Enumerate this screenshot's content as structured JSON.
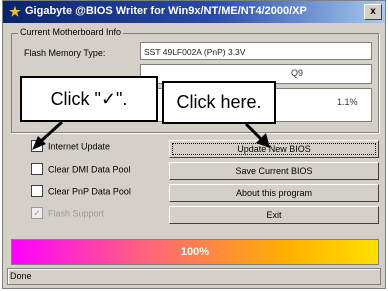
{
  "window": {
    "title": "Gigabyte @BIOS Writer for Win9x/NT/ME/NT4/2000/XP",
    "close_label": "x"
  },
  "info": {
    "legend": "Current Motherboard Info",
    "flash_label": "Flash Memory Type:",
    "flash_value": "SST 49LF002A (PnP) 3.3V",
    "frag1": "Q9",
    "frag2": "1.1%"
  },
  "options": [
    {
      "label": "Internet Update",
      "checked": false,
      "disabled": false
    },
    {
      "label": "Clear DMI Data Pool",
      "checked": false,
      "disabled": false
    },
    {
      "label": "Clear PnP Data Pool",
      "checked": false,
      "disabled": false
    },
    {
      "label": "Flash Support",
      "checked": true,
      "disabled": true
    }
  ],
  "buttons": [
    {
      "label": "Update New BIOS"
    },
    {
      "label": "Save Current BIOS"
    },
    {
      "label": "About this program"
    },
    {
      "label": "Exit"
    }
  ],
  "progress": {
    "value": 100,
    "text": "100%"
  },
  "status": {
    "text": "Done"
  },
  "callouts": {
    "check": "Click \"✓\".",
    "here": "Click here."
  }
}
